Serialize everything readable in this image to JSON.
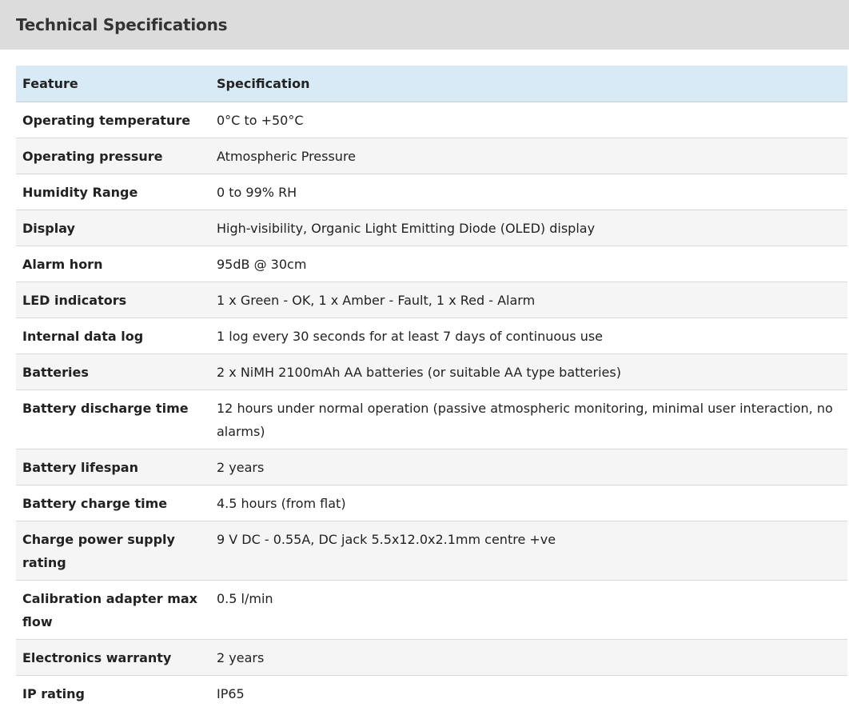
{
  "header": {
    "title": "Technical Specifications"
  },
  "table": {
    "columns": [
      "Feature",
      "Specification"
    ],
    "rows": [
      {
        "feature": "Operating temperature",
        "spec": "0°C to +50°C"
      },
      {
        "feature": "Operating pressure",
        "spec": "Atmospheric Pressure"
      },
      {
        "feature": "Humidity Range",
        "spec": "0 to 99% RH"
      },
      {
        "feature": "Display",
        "spec": "High-visibility, Organic Light Emitting Diode (OLED) display"
      },
      {
        "feature": "Alarm horn",
        "spec": "95dB @ 30cm"
      },
      {
        "feature": "LED indicators",
        "spec": "1 x Green - OK, 1 x Amber - Fault, 1 x Red - Alarm"
      },
      {
        "feature": "Internal data log",
        "spec": "1 log every 30 seconds for at least 7 days of continuous use"
      },
      {
        "feature": "Batteries",
        "spec": "2 x NiMH 2100mAh AA batteries (or suitable AA type batteries)"
      },
      {
        "feature": "Battery discharge time",
        "spec": "12 hours under normal operation (passive atmospheric monitoring, minimal user interaction, no alarms)"
      },
      {
        "feature": "Battery lifespan",
        "spec": "2 years"
      },
      {
        "feature": "Battery charge time",
        "spec": "4.5 hours (from flat)"
      },
      {
        "feature": "Charge power supply rating",
        "spec": "9 V DC - 0.55A, DC jack 5.5x12.0x2.1mm centre +ve"
      },
      {
        "feature": "Calibration adapter max flow",
        "spec": "0.5 l/min"
      },
      {
        "feature": "Electronics warranty",
        "spec": "2 years"
      },
      {
        "feature": "IP rating",
        "spec": "IP65"
      }
    ]
  }
}
